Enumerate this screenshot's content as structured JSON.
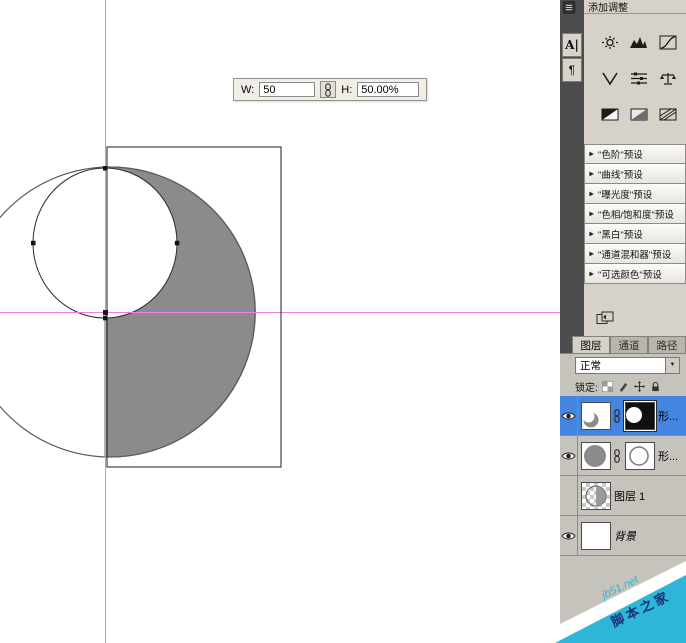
{
  "colors": {
    "selection_blue": "#4485e0",
    "shape_gray": "#8b8b8b",
    "guide_pink": "#ef7fe3",
    "watermark_cyan": "#2eb6d9",
    "watermark_navy": "#16337a"
  },
  "canvas": {
    "transform_bar": {
      "w_label": "W:",
      "w_value": "50",
      "link_icon": "maintain-aspect-ratio-chain",
      "h_label": "H:",
      "h_value": "50.00%"
    }
  },
  "dock": {
    "panel_menu_icon": "panel-list",
    "character_button": "A|",
    "paragraph_button": "¶"
  },
  "adjustments": {
    "header": "添加调整",
    "preset_arrow": "▶",
    "icons": [
      "brightness-contrast",
      "levels",
      "curves",
      "vibrance",
      "hue-saturation",
      "color-balance",
      "black-white",
      "photo-filter",
      "channel-mixer"
    ],
    "presets": [
      "\"色阶\"预设",
      "\"曲线\"预设",
      "\"曝光度\"预设",
      "\"色相/饱和度\"预设",
      "\"黑白\"预设",
      "\"通道混和器\"预设",
      "\"可选颜色\"预设"
    ]
  },
  "layers": {
    "tabs": [
      "图层",
      "通道",
      "路径"
    ],
    "blend_mode": "正常",
    "dropdown_arrow": "▼",
    "lock_label": "锁定:",
    "lock_icons": [
      "lock-transparency",
      "lock-pixels",
      "lock-position",
      "lock-all"
    ],
    "rows": [
      {
        "name": "形...",
        "visible": true,
        "selected": true,
        "has_mask": true
      },
      {
        "name": "形...",
        "visible": true,
        "selected": false,
        "has_mask": true
      },
      {
        "name": "图层 1",
        "visible": false,
        "selected": false,
        "has_mask": false
      },
      {
        "name": "背景",
        "visible": true,
        "selected": false,
        "has_mask": false
      }
    ]
  },
  "watermark": {
    "site": "jb51.net",
    "name": "脚本之家"
  }
}
